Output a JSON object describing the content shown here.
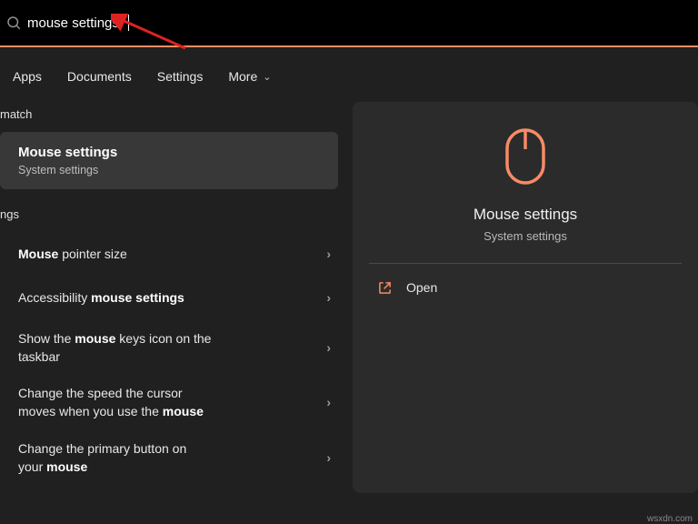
{
  "accent_color": "#f78b66",
  "search": {
    "value": "mouse settings"
  },
  "tabs": {
    "items": [
      "Apps",
      "Documents",
      "Settings",
      "More"
    ]
  },
  "sections": {
    "best_match_label": "match",
    "settings_label": "ngs"
  },
  "best_match": {
    "title": "Mouse settings",
    "subtitle": "System settings"
  },
  "settings_results": [
    {
      "prefix": "Mouse",
      "rest": " pointer size"
    },
    {
      "prefix": "",
      "rest": "Accessibility ",
      "bold2": "mouse settings"
    },
    {
      "line1": "Show the ",
      "bold": "mouse",
      "line1b": " keys icon on the",
      "line2": "taskbar"
    },
    {
      "line1": "Change the speed the cursor",
      "line2a": "moves when you use the ",
      "bold": "mouse"
    },
    {
      "line1": "Change the primary button on",
      "line2a": "your ",
      "bold": "mouse"
    }
  ],
  "preview": {
    "title": "Mouse settings",
    "subtitle": "System settings",
    "action_open": "Open"
  },
  "watermark": "wsxdn.com"
}
